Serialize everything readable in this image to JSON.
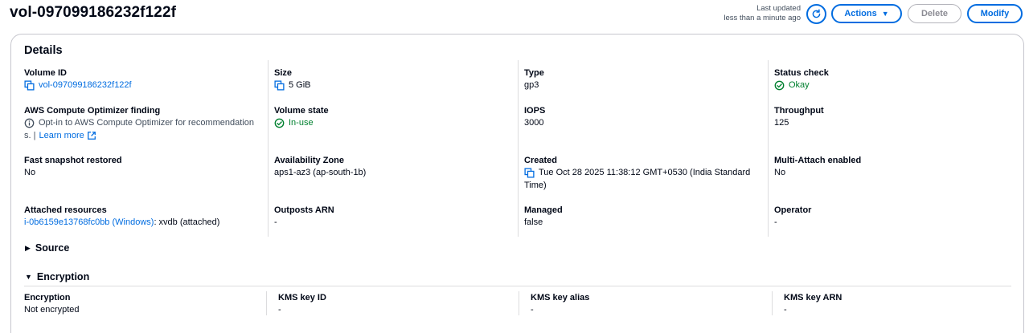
{
  "header": {
    "title": "vol-097099186232f122f",
    "last_updated_line1": "Last updated",
    "last_updated_line2": "less than a minute ago",
    "actions_label": "Actions",
    "delete_label": "Delete",
    "modify_label": "Modify"
  },
  "details": {
    "title": "Details",
    "volume_id": {
      "label": "Volume ID",
      "value": "vol-097099186232f122f"
    },
    "size": {
      "label": "Size",
      "value": "5 GiB"
    },
    "type": {
      "label": "Type",
      "value": "gp3"
    },
    "status_check": {
      "label": "Status check",
      "value": "Okay"
    },
    "optimizer": {
      "label": "AWS Compute Optimizer finding",
      "value_line1": "Opt-in to AWS Compute Optimizer for recommendation",
      "value_line2_prefix": "s. |",
      "link": "Learn more"
    },
    "volume_state": {
      "label": "Volume state",
      "value": "In-use"
    },
    "iops": {
      "label": "IOPS",
      "value": "3000"
    },
    "throughput": {
      "label": "Throughput",
      "value": "125"
    },
    "fast_snapshot": {
      "label": "Fast snapshot restored",
      "value": "No"
    },
    "availability_zone": {
      "label": "Availability Zone",
      "value": "aps1-az3 (ap-south-1b)"
    },
    "created": {
      "label": "Created",
      "value_line1": "Tue Oct 28 2025 11:38:12 GMT+0530 (India Standard",
      "value_line2": "Time)"
    },
    "multi_attach": {
      "label": "Multi-Attach enabled",
      "value": "No"
    },
    "attached": {
      "label": "Attached resources",
      "link": "i-0b6159e13768fc0bb (Windows)",
      "suffix": ": xvdb (attached)"
    },
    "outposts": {
      "label": "Outposts ARN",
      "value": "-"
    },
    "managed": {
      "label": "Managed",
      "value": "false"
    },
    "operator": {
      "label": "Operator",
      "value": "-"
    }
  },
  "source": {
    "label": "Source"
  },
  "encryption": {
    "label": "Encryption",
    "encryption": {
      "label": "Encryption",
      "value": "Not encrypted"
    },
    "kms_key_id": {
      "label": "KMS key ID",
      "value": "-"
    },
    "kms_key_alias": {
      "label": "KMS key alias",
      "value": "-"
    },
    "kms_key_arn": {
      "label": "KMS key ARN",
      "value": "-"
    }
  },
  "colors": {
    "link": "#006ce0",
    "success": "#00802f",
    "text": "#000716",
    "border": "#c6c6cd"
  },
  "icons": [
    "copy-icon",
    "refresh-icon",
    "check-circle-icon",
    "info-icon",
    "external-link-icon",
    "caret-down-icon",
    "caret-right-icon"
  ]
}
